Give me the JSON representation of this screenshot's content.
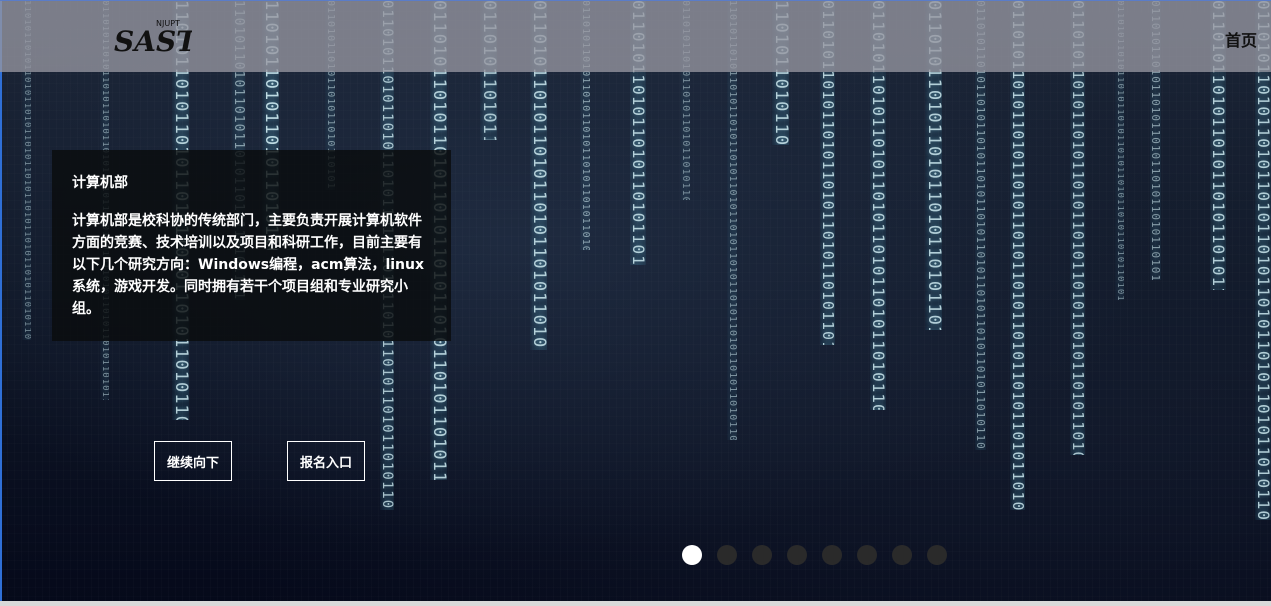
{
  "header": {
    "logo_text": "SAST",
    "logo_sub": "NJUPT",
    "nav_home": "首页"
  },
  "info": {
    "title": "计算机部",
    "body": "计算机部是校科协的传统部门，主要负责开展计算机软件方面的竞赛、技术培训以及项目和科研工作，目前主要有以下几个研究方向：Windows编程，acm算法，linux系统，游戏开发。同时拥有若干个项目组和专业研究小组。"
  },
  "buttons": {
    "continue_label": "继续向下",
    "signup_label": "报名入口"
  },
  "carousel": {
    "total": 8,
    "active": 1
  },
  "colors": {
    "header_bg": "#9696a0",
    "panel_bg": "#0a0c0e",
    "rain": "#cfeef5",
    "dot_active": "#ffffff",
    "dot_inactive": "#2a2a2a"
  }
}
